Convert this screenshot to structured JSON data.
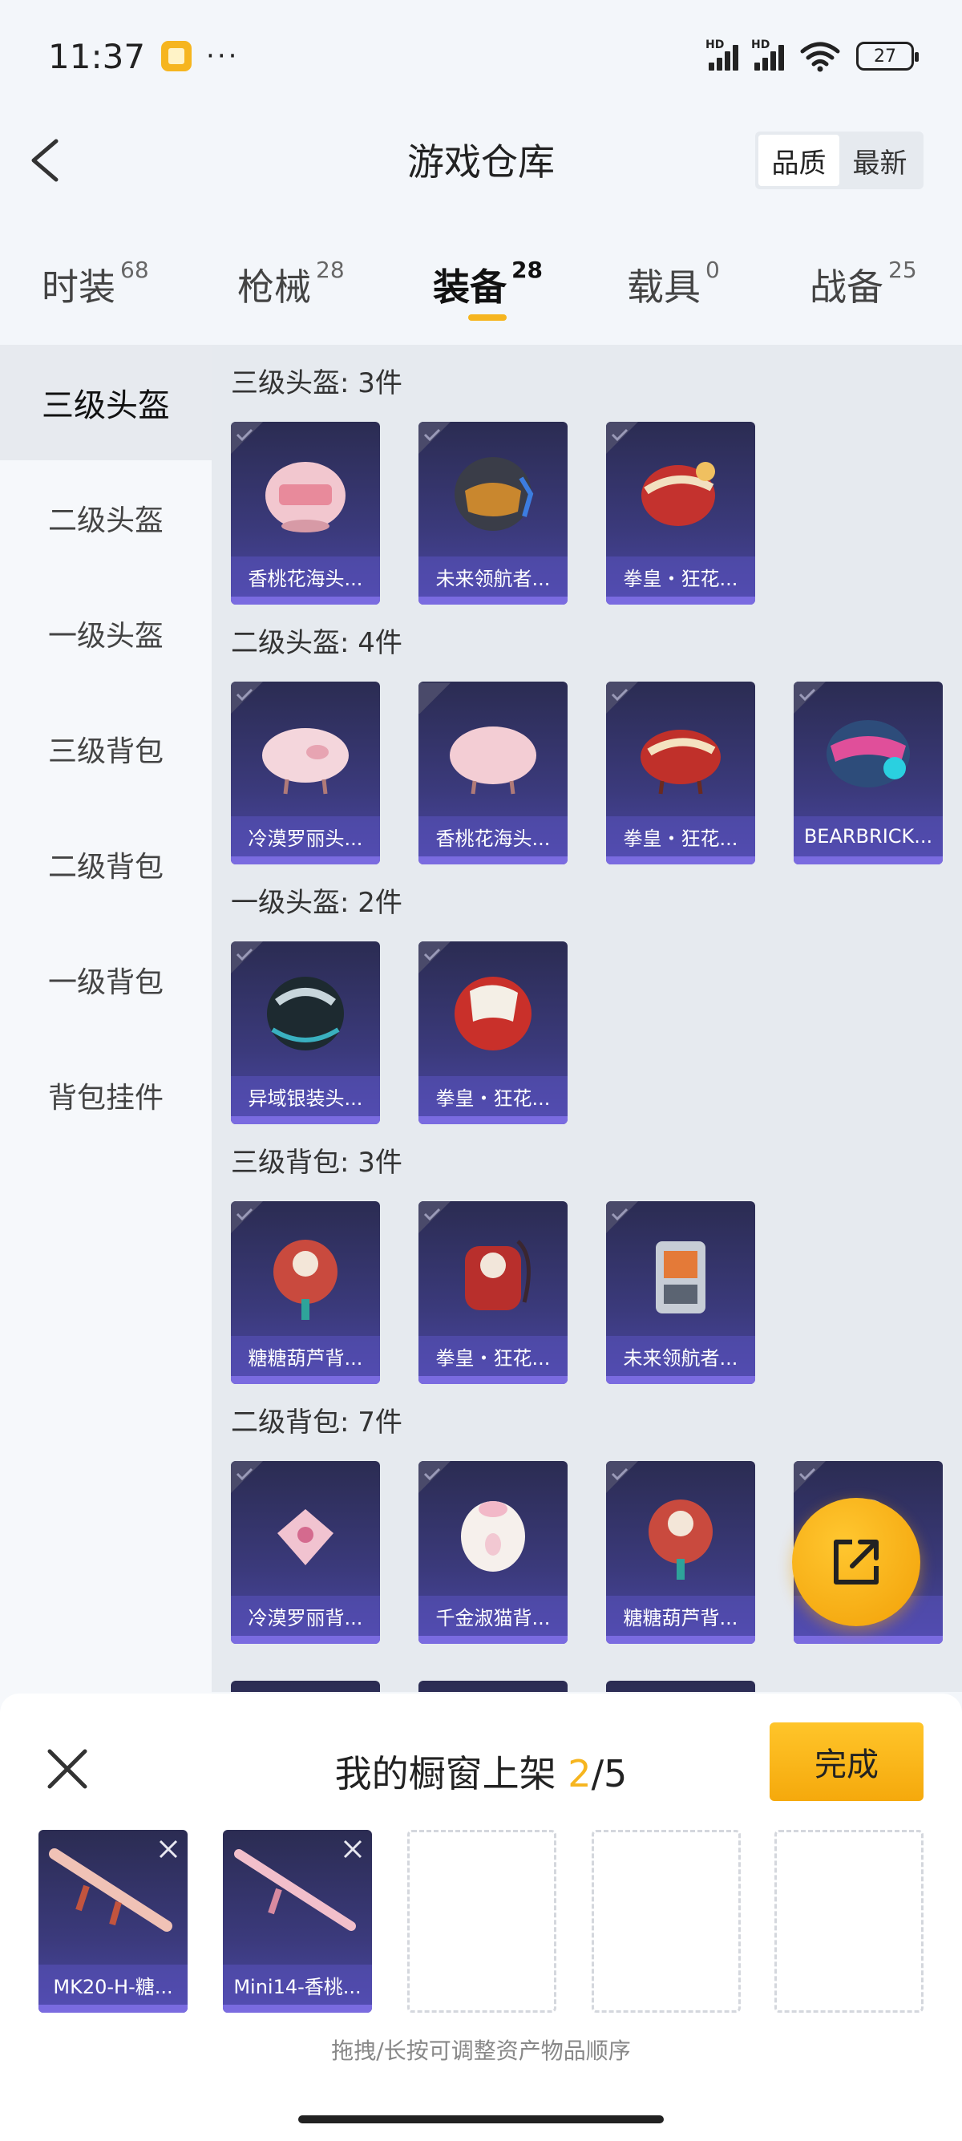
{
  "status_bar": {
    "time": "11:37",
    "more": "···",
    "battery": "27",
    "hd1": "HD",
    "hd2": "HD"
  },
  "header": {
    "title": "游戏仓库",
    "sort_options": [
      "品质",
      "最新"
    ]
  },
  "tabs": [
    {
      "label": "时装",
      "count": "68"
    },
    {
      "label": "枪械",
      "count": "28"
    },
    {
      "label": "装备",
      "count": "28"
    },
    {
      "label": "载具",
      "count": "0"
    },
    {
      "label": "战备",
      "count": "25"
    }
  ],
  "sidebar": {
    "items": [
      "三级头盔",
      "二级头盔",
      "一级头盔",
      "三级背包",
      "二级背包",
      "一级背包",
      "背包挂件"
    ]
  },
  "groups": [
    {
      "title": "三级头盔: 3件",
      "items": [
        "香桃花海头...",
        "未来领航者...",
        "拳皇・狂花..."
      ]
    },
    {
      "title": "二级头盔: 4件",
      "items": [
        "冷漠罗丽头...",
        "香桃花海头...",
        "拳皇・狂花...",
        "BEARBRICK..."
      ]
    },
    {
      "title": "一级头盔: 2件",
      "items": [
        "异域银装头...",
        "拳皇・狂花..."
      ]
    },
    {
      "title": "三级背包: 3件",
      "items": [
        "糖糖葫芦背...",
        "拳皇・狂花...",
        "未来领航者..."
      ]
    },
    {
      "title": "二级背包: 7件",
      "items": [
        "冷漠罗丽背...",
        "千金淑猫背...",
        "糖糖葫芦背...",
        "..."
      ]
    }
  ],
  "showcase": {
    "title_prefix": "我的橱窗上架 ",
    "current": "2",
    "total": "/5",
    "done_label": "完成",
    "slots": [
      "MK20-H-糖...",
      "Mini14-香桃...",
      "",
      "",
      ""
    ],
    "hint": "拖拽/长按可调整资产物品顺序"
  },
  "colors": {
    "accent": "#f6b51f",
    "card_top": "#2b2c52",
    "card_bottom": "#4b47a4"
  }
}
